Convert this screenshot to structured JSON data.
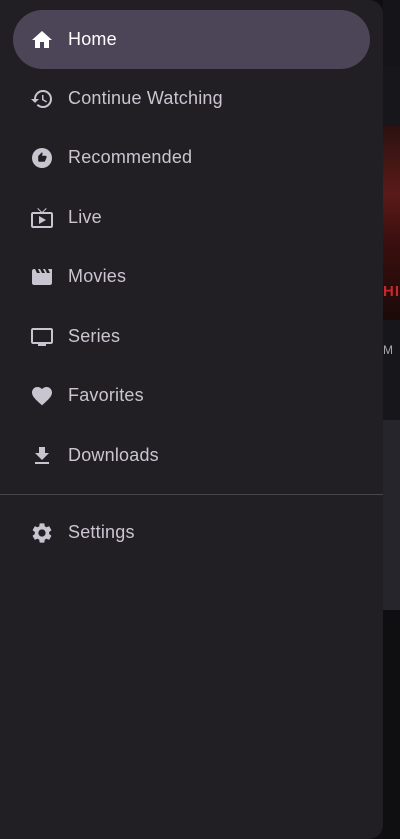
{
  "background": {
    "poster_text": "HIC",
    "meta_text": "M"
  },
  "nav": {
    "items": [
      {
        "label": "Home",
        "icon": "home-icon",
        "active": true
      },
      {
        "label": "Continue Watching",
        "icon": "history-icon",
        "active": false
      },
      {
        "label": "Recommended",
        "icon": "thumb-up-icon",
        "active": false
      },
      {
        "label": "Live",
        "icon": "live-tv-icon",
        "active": false
      },
      {
        "label": "Movies",
        "icon": "movie-icon",
        "active": false
      },
      {
        "label": "Series",
        "icon": "tv-icon",
        "active": false
      },
      {
        "label": "Favorites",
        "icon": "heart-icon",
        "active": false
      },
      {
        "label": "Downloads",
        "icon": "download-icon",
        "active": false
      }
    ],
    "settings": {
      "label": "Settings",
      "icon": "gear-icon"
    }
  },
  "colors": {
    "drawer_bg": "#211f24",
    "active_pill": "#4b4557",
    "text": "#cac5d0",
    "divider": "#48454e"
  }
}
